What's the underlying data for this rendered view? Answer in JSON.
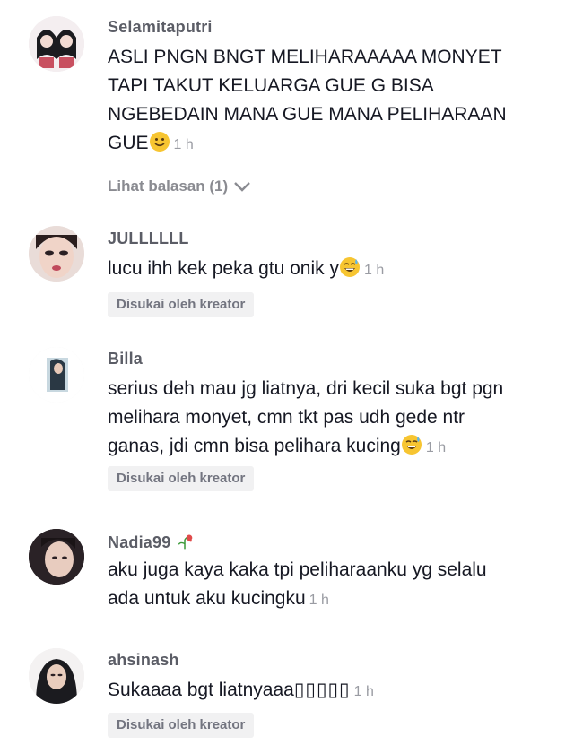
{
  "comments": [
    {
      "username": "Selamitaputri",
      "lines": [
        "ASLI PNGN BNGT MELIHARAAAAA MONYET",
        "TAPI TAKUT KELUARGA GUE G BISA",
        "NGEBEDAIN MANA GUE MANA PELIHARAAN",
        "GUE"
      ],
      "emoji": "slightly-smiling-face",
      "time": "1 h",
      "replies_label": "Lihat balasan (1)"
    },
    {
      "username": "JULLLLLL",
      "lines": [
        "lucu ihh kek peka gtu onik y"
      ],
      "emoji": "grinning-sweat-face",
      "time": "1 h",
      "badge": "Disukai oleh kreator"
    },
    {
      "username": "Billa",
      "lines": [
        "serius deh mau jg liatnya, dri kecil suka bgt pgn",
        "melihara monyet, cmn tkt pas udh gede ntr",
        "ganas, jdi cmn bisa pelihara kucing"
      ],
      "emoji": "grinning-sweat-face",
      "time": "1 h",
      "badge": "Disukai oleh kreator"
    },
    {
      "username": "Nadia99",
      "username_emoji": "wilted-flower",
      "lines": [
        "aku juga kaya kaka tpi peliharaanku yg selalu",
        "ada untuk aku kucingku"
      ],
      "time": "1 h"
    },
    {
      "username": "ahsinash",
      "lines": [
        "Sukaaaa bgt liatnyaaa"
      ],
      "trailing_glyphs": "▯▯▯▯▯",
      "time": "1 h",
      "badge": "Disukai oleh kreator"
    }
  ],
  "colors": {
    "text": "#161823",
    "username": "#5b5d66",
    "meta": "#9a9ca3",
    "badge_bg": "#f1f1f2"
  }
}
